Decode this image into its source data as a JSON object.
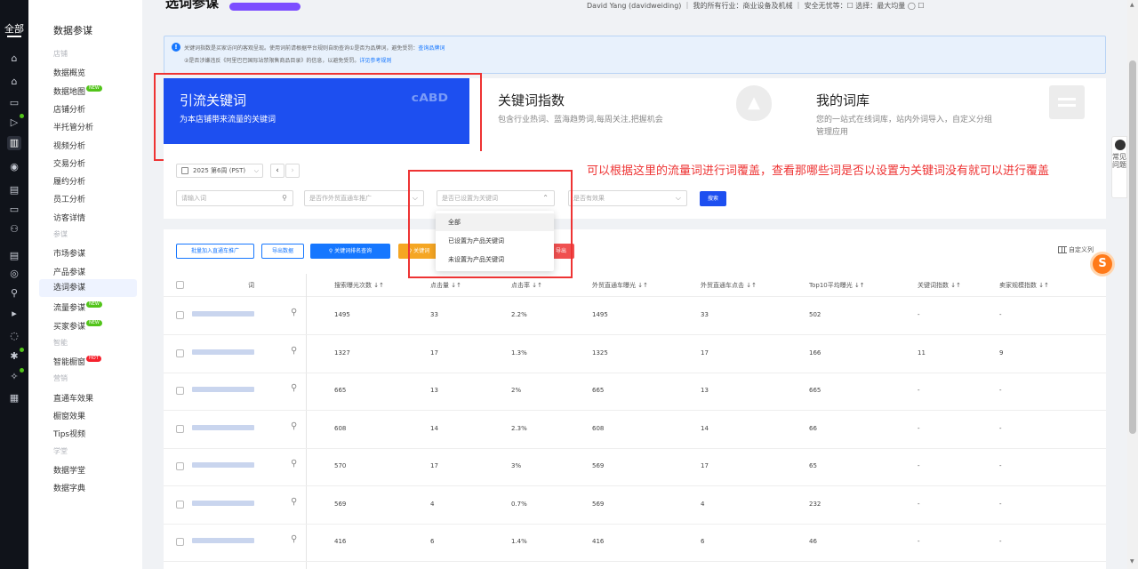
{
  "rail": {
    "all_label": "全部",
    "icons": [
      "home-icon",
      "shop-icon",
      "calendar-icon",
      "tv-icon",
      "chart-icon",
      "signal-icon",
      "store-icon",
      "message-icon",
      "group-icon",
      "doc-icon",
      "compass-icon",
      "user-icon",
      "play-icon",
      "shield-icon",
      "spark-icon",
      "magic-icon",
      "printer-icon"
    ]
  },
  "sidenav": {
    "brand": "数据参谋",
    "items": [
      {
        "label": "店铺",
        "group": true
      },
      {
        "label": "数据概览"
      },
      {
        "label": "数据地图",
        "badge": "NEW"
      },
      {
        "label": "店铺分析"
      },
      {
        "label": "半托管分析"
      },
      {
        "label": "视频分析"
      },
      {
        "label": "交易分析"
      },
      {
        "label": "履约分析"
      },
      {
        "label": "员工分析"
      },
      {
        "label": "访客详情"
      },
      {
        "label": "参谋",
        "group": true
      },
      {
        "label": "市场参谋"
      },
      {
        "label": "产品参谋"
      },
      {
        "label": "选词参谋",
        "selected": true
      },
      {
        "label": "流量参谋",
        "badge": "NEW"
      },
      {
        "label": "买家参谋",
        "badge": "NEW"
      },
      {
        "label": "智能",
        "group": true
      },
      {
        "label": "智能橱窗",
        "badge": "HOT"
      },
      {
        "label": "营销",
        "group": true
      },
      {
        "label": "直通车效果"
      },
      {
        "label": "橱窗效果"
      },
      {
        "label": "Tips视频"
      },
      {
        "label": "学堂",
        "group": true
      },
      {
        "label": "数据学堂"
      },
      {
        "label": "数据字典"
      }
    ]
  },
  "header": {
    "title": "选词参谋",
    "user_text": "David Yang (davidweiding) ｜ 我的所有行业：商业设备及机械 ｜ 安全无忧等：☐  选择：最大均量 ◯  ☐"
  },
  "notice": {
    "line1": "关键词指数是买家访问的客观呈现。使用词前请根据平台规则自助查询①是否为品牌词，避免受罚：",
    "line1_link": "查询品牌词",
    "line2": "②是否涉嫌违反《阿里巴巴国际站禁限售商品目录》的信息，以避免受罚。",
    "line2_link": "详见参考规则"
  },
  "cards": [
    {
      "title": "引流关键词",
      "desc": "为本店铺带来流量的关键词",
      "icon": "ABCD-icon"
    },
    {
      "title": "关键词指数",
      "desc": "包含行业热词、蓝海趋势词,每周关注,把握机会",
      "icon": "fire-icon"
    },
    {
      "title": "我的词库",
      "desc": "您的一站式在线词库，站内外词导入，自定义分组管理应用",
      "icon": "library-icon"
    }
  ],
  "filters": {
    "week": "2025 第6周 (PST)",
    "keyword_placeholder": "请输入词",
    "select1": "是否作外贸直通车推广",
    "select2": "是否已设置为关键词",
    "select3": "是否有效果",
    "search": "搜索"
  },
  "dropdown": {
    "options": [
      "全部",
      "已设置为产品关键词",
      "未设置为产品关键词"
    ],
    "highlighted": 0
  },
  "annotation": "可以根据这里的流量词进行词覆盖，查看那哪些词是否以设置为关键词没有就可以进行覆盖",
  "toolbar": {
    "batch": "批量加入直通车推广",
    "export": "导出数据",
    "rank": "关键词排名查询",
    "orange": "关键词",
    "red": "导出",
    "custom": "自定义列"
  },
  "table": {
    "headers": [
      "词",
      "搜索曝光次数 ↓↑",
      "点击量 ↓↑",
      "点击率 ↓↑",
      "外贸直通车曝光 ↓↑",
      "外贸直通车点击 ↓↑",
      "Top10平均曝光 ↓↑",
      "关键词指数 ↓↑",
      "卖家规模指数 ↓↑"
    ],
    "rows": [
      [
        "1495",
        "33",
        "2.2%",
        "1495",
        "33",
        "502",
        "-",
        "-"
      ],
      [
        "1327",
        "17",
        "1.3%",
        "1325",
        "17",
        "166",
        "11",
        "9"
      ],
      [
        "665",
        "13",
        "2%",
        "665",
        "13",
        "665",
        "-",
        "-"
      ],
      [
        "608",
        "14",
        "2.3%",
        "608",
        "14",
        "66",
        "-",
        "-"
      ],
      [
        "570",
        "17",
        "3%",
        "569",
        "17",
        "65",
        "-",
        "-"
      ],
      [
        "569",
        "4",
        "0.7%",
        "569",
        "4",
        "232",
        "-",
        "-"
      ],
      [
        "416",
        "6",
        "1.4%",
        "416",
        "6",
        "46",
        "-",
        "-"
      ]
    ]
  },
  "help": {
    "label": "常见问题"
  },
  "float": {
    "label": "S"
  }
}
